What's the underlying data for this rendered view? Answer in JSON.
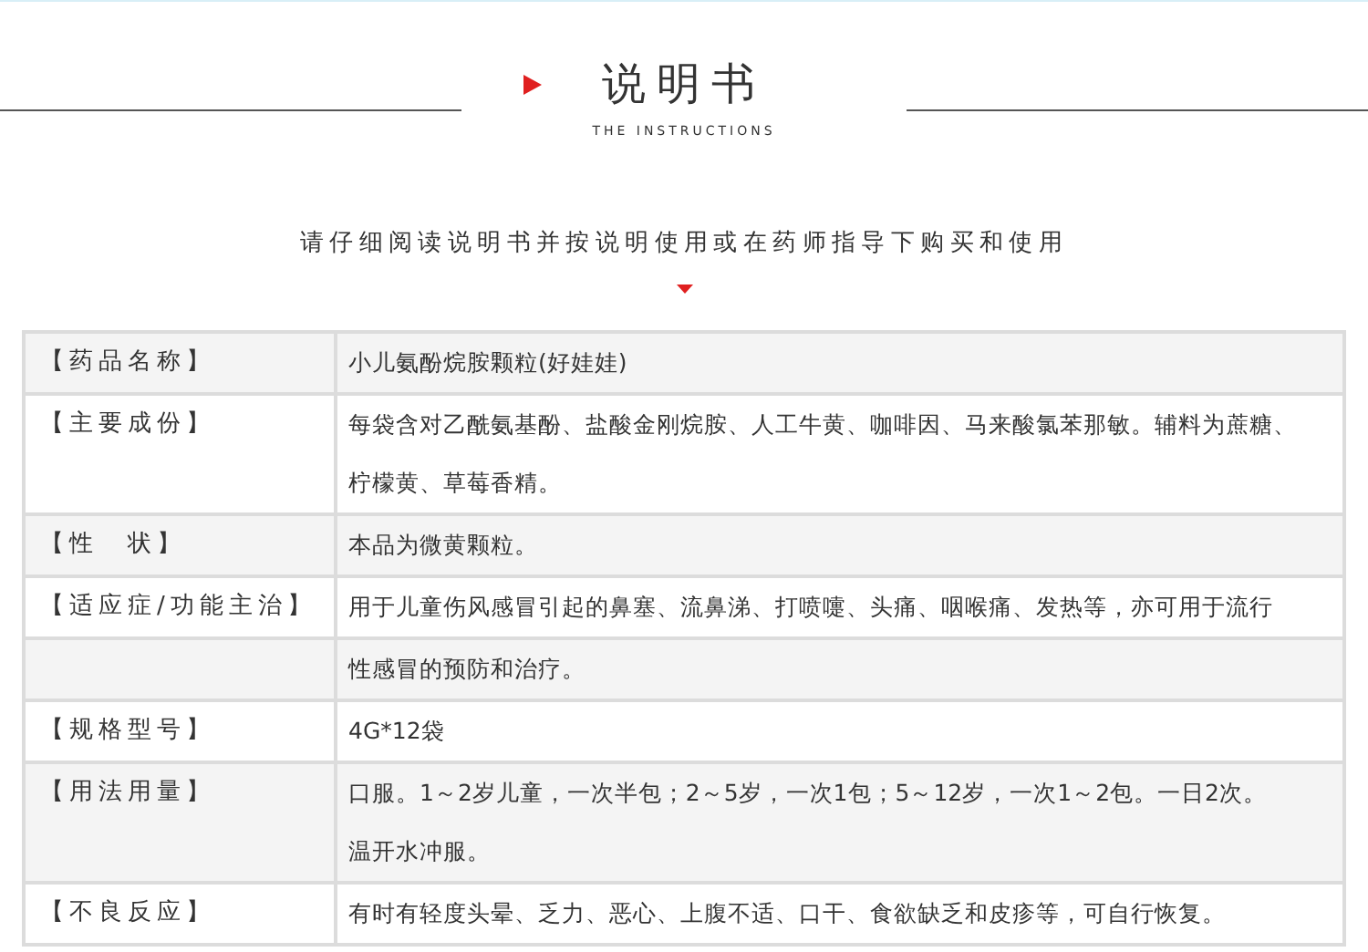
{
  "header": {
    "title": "说明书",
    "subtitle": "THE INSTRUCTIONS",
    "notice": "请仔细阅读说明书并按说明使用或在药师指导下购买和使用"
  },
  "table": {
    "rows": [
      {
        "label": "【药品名称】",
        "lines": [
          "小儿氨酚烷胺颗粒(好娃娃)"
        ]
      },
      {
        "label": "【主要成份】",
        "lines": [
          "每袋含对乙酰氨基酚、盐酸金刚烷胺、人工牛黄、咖啡因、马来酸氯苯那敏。辅料为蔗糖、",
          "柠檬黄、草莓香精。"
        ]
      },
      {
        "label": "【性　状】",
        "lines": [
          "本品为微黄颗粒。"
        ]
      },
      {
        "label": "【适应症/功能主治】",
        "lines": [
          "用于儿童伤风感冒引起的鼻塞、流鼻涕、打喷嚏、头痛、咽喉痛、发热等，亦可用于流行"
        ]
      },
      {
        "lines": [
          "性感冒的预防和治疗。"
        ]
      },
      {
        "label": "【规格型号】",
        "lines": [
          "4G*12袋"
        ]
      },
      {
        "label": "【用法用量】",
        "lines": [
          "口服。1～2岁儿童，一次半包；2～5岁，一次1包；5～12岁，一次1～2包。一日2次。",
          "温开水冲服。"
        ]
      },
      {
        "label": "【不良反应】",
        "lines": [
          "有时有轻度头晕、乏力、恶心、上腹不适、口干、食欲缺乏和皮疹等，可自行恢复。"
        ]
      }
    ]
  }
}
